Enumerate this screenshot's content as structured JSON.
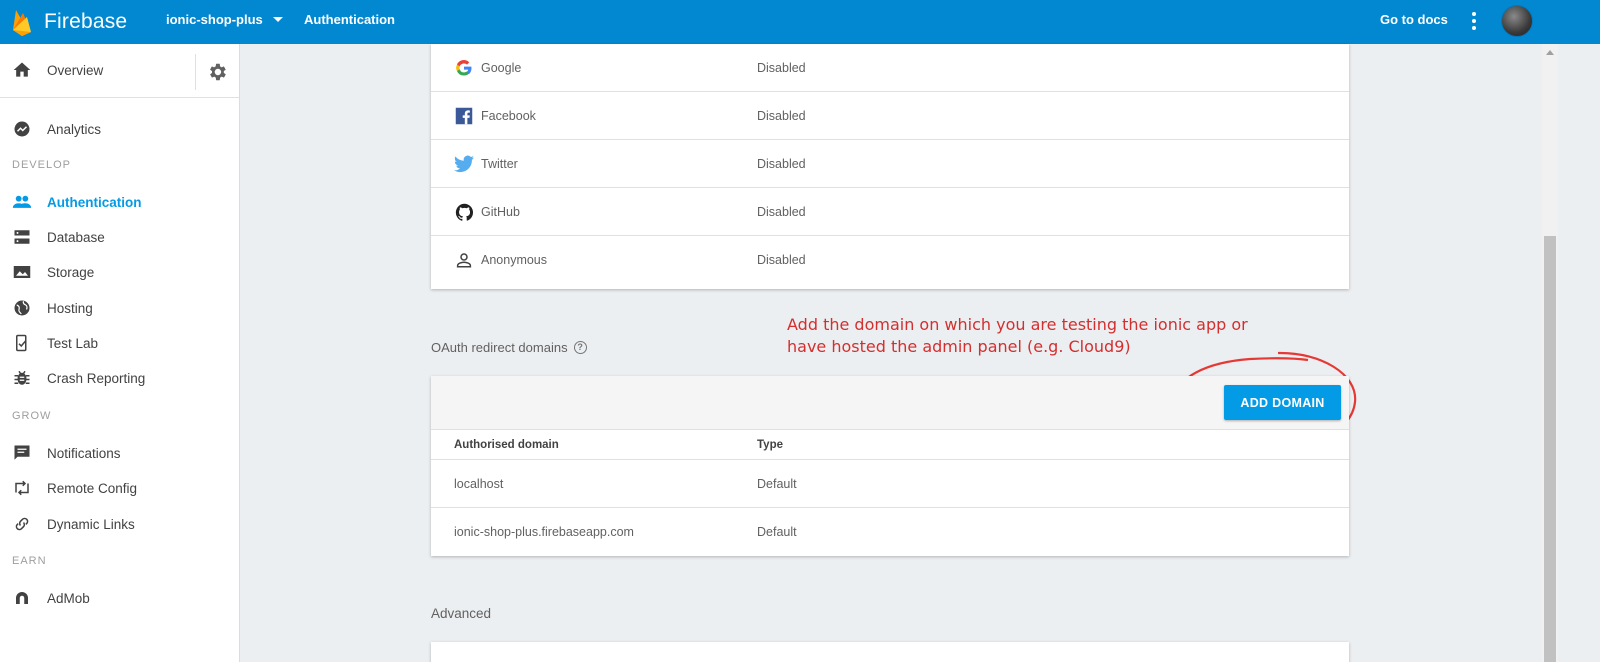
{
  "topbar": {
    "app_name": "Firebase",
    "project_name": "ionic-shop-plus",
    "section": "Authentication",
    "docs_link": "Go to docs",
    "accent_color": "#0288d1"
  },
  "sidebar": {
    "overview": "Overview",
    "analytics": "Analytics",
    "groups": {
      "develop": "DEVELOP",
      "grow": "GROW",
      "earn": "EARN"
    },
    "develop_items": [
      {
        "label": "Authentication",
        "icon": "people-icon",
        "active": true
      },
      {
        "label": "Database",
        "icon": "database-icon"
      },
      {
        "label": "Storage",
        "icon": "image-icon"
      },
      {
        "label": "Hosting",
        "icon": "globe-icon"
      },
      {
        "label": "Test Lab",
        "icon": "test-lab-icon"
      },
      {
        "label": "Crash Reporting",
        "icon": "bug-icon"
      }
    ],
    "grow_items": [
      {
        "label": "Notifications",
        "icon": "message-icon"
      },
      {
        "label": "Remote Config",
        "icon": "remote-config-icon"
      },
      {
        "label": "Dynamic Links",
        "icon": "link-icon"
      }
    ],
    "earn_items": [
      {
        "label": "AdMob",
        "icon": "admob-icon"
      }
    ]
  },
  "providers": [
    {
      "name": "Google",
      "status": "Disabled",
      "icon": "google-icon"
    },
    {
      "name": "Facebook",
      "status": "Disabled",
      "icon": "facebook-icon"
    },
    {
      "name": "Twitter",
      "status": "Disabled",
      "icon": "twitter-icon"
    },
    {
      "name": "GitHub",
      "status": "Disabled",
      "icon": "github-icon"
    },
    {
      "name": "Anonymous",
      "status": "Disabled",
      "icon": "person-icon"
    }
  ],
  "oauth": {
    "label": "OAuth redirect domains",
    "add_button": "ADD DOMAIN",
    "columns": [
      "Authorised domain",
      "Type"
    ],
    "rows": [
      {
        "domain": "localhost",
        "type": "Default"
      },
      {
        "domain": "ionic-shop-plus.firebaseapp.com",
        "type": "Default"
      }
    ]
  },
  "advanced_label": "Advanced",
  "annotation": {
    "line1": "Add the domain on which you are testing the ionic app or",
    "line2": "have hosted the admin panel (e.g. Cloud9)",
    "color": "#d32f2f"
  }
}
